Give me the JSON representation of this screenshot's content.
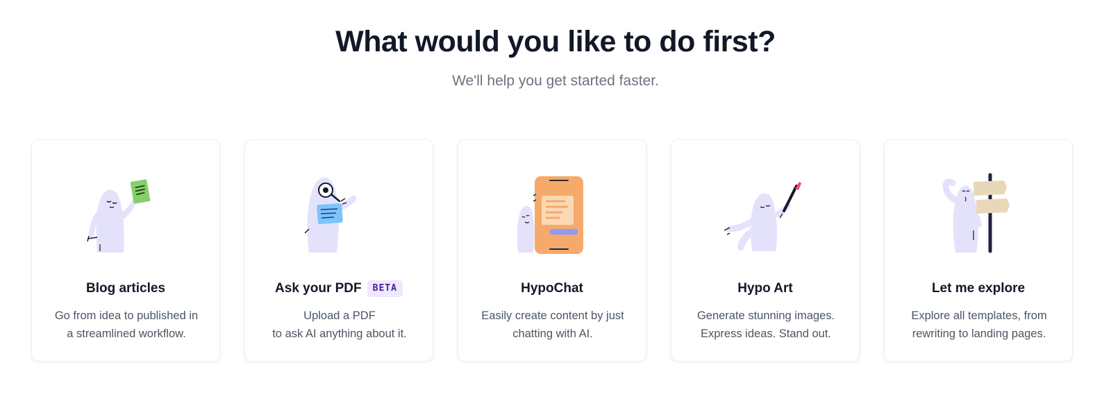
{
  "header": {
    "title": "What would you like to do first?",
    "subtitle": "We'll help you get started faster."
  },
  "colors": {
    "mascot": "#e4e2fb",
    "accent_orange": "#f5a96b",
    "badge_bg": "#ede9fe",
    "badge_text": "#4c1d95"
  },
  "cards": [
    {
      "title": "Blog articles",
      "description": [
        "Go from idea to published in",
        "a streamlined workflow."
      ],
      "icon": "blog-illustration-icon"
    },
    {
      "title": "Ask your PDF",
      "badge": "BETA",
      "description": [
        "Upload a PDF",
        "to ask AI anything about it."
      ],
      "icon": "pdf-magnifier-illustration-icon"
    },
    {
      "title": "HypoChat",
      "description": [
        "Easily create content by just",
        "chatting with AI."
      ],
      "icon": "chat-phone-illustration-icon"
    },
    {
      "title": "Hypo Art",
      "description": [
        "Generate stunning images.",
        "Express ideas. Stand out."
      ],
      "icon": "paintbrush-illustration-icon"
    },
    {
      "title": "Let me explore",
      "description": [
        "Explore all templates, from",
        "rewriting to landing pages."
      ],
      "icon": "signpost-illustration-icon"
    }
  ]
}
